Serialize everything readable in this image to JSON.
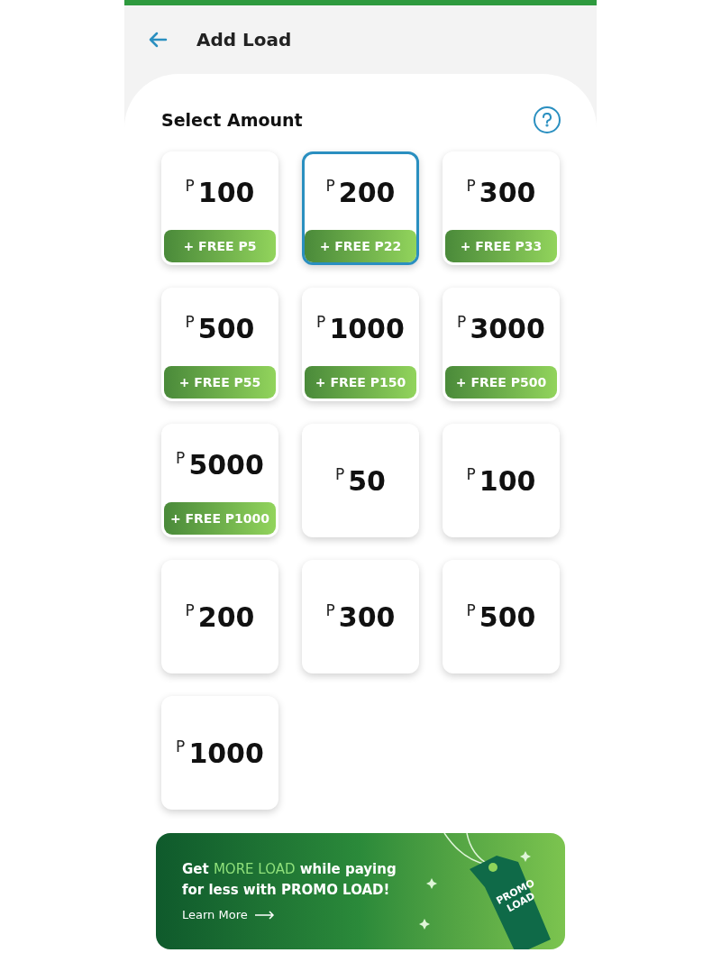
{
  "header": {
    "title": "Add Load"
  },
  "section": {
    "title": "Select Amount"
  },
  "cards": [
    {
      "currency": "P",
      "amount": "100",
      "bonus": "+ FREE P5",
      "selected": false
    },
    {
      "currency": "P",
      "amount": "200",
      "bonus": "+ FREE P22",
      "selected": true
    },
    {
      "currency": "P",
      "amount": "300",
      "bonus": "+ FREE P33",
      "selected": false
    },
    {
      "currency": "P",
      "amount": "500",
      "bonus": "+ FREE P55",
      "selected": false
    },
    {
      "currency": "P",
      "amount": "1000",
      "bonus": "+ FREE P150",
      "selected": false
    },
    {
      "currency": "P",
      "amount": "3000",
      "bonus": "+ FREE P500",
      "selected": false
    },
    {
      "currency": "P",
      "amount": "5000",
      "bonus": "+ FREE P1000",
      "selected": false
    },
    {
      "currency": "P",
      "amount": "50",
      "selected": false
    },
    {
      "currency": "P",
      "amount": "100",
      "selected": false
    },
    {
      "currency": "P",
      "amount": "200",
      "selected": false
    },
    {
      "currency": "P",
      "amount": "300",
      "selected": false
    },
    {
      "currency": "P",
      "amount": "500",
      "selected": false
    },
    {
      "currency": "P",
      "amount": "1000",
      "selected": false
    }
  ],
  "banner": {
    "headline_start": "Get ",
    "headline_highlight": "MORE LOAD",
    "headline_end": " while paying for less with PROMO LOAD!",
    "link": "Learn More",
    "tag_text": "PROMO LOAD"
  }
}
